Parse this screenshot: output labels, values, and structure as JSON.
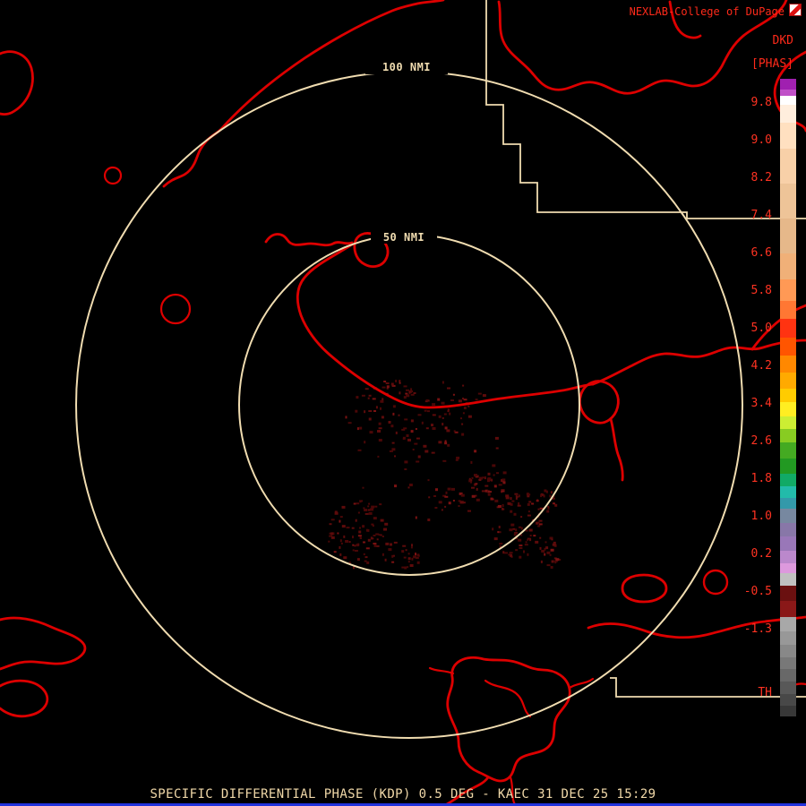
{
  "header": {
    "brand": "NEXLAB-College of DuPage",
    "product_code": "DKD",
    "units_label": "[PHAS]"
  },
  "colorbar": {
    "tick_labels": [
      "9.8",
      "9.0",
      "8.2",
      "7.4",
      "6.6",
      "5.8",
      "5.0",
      "4.2",
      "3.4",
      "2.6",
      "1.8",
      "1.0",
      "0.2",
      "-0.5",
      "-1.3"
    ],
    "threshold_label": "TH",
    "segments": [
      [
        "#a020b0",
        12
      ],
      [
        "#c050c8",
        8
      ],
      [
        "#ffffff",
        10
      ],
      [
        "#ffeedd",
        20
      ],
      [
        "#ffe0c0",
        30
      ],
      [
        "#f8d0a8",
        40
      ],
      [
        "#eec498",
        40
      ],
      [
        "#e6b88a",
        40
      ],
      [
        "#f0b078",
        30
      ],
      [
        "#ff9955",
        25
      ],
      [
        "#ff7733",
        20
      ],
      [
        "#ff3311",
        22
      ],
      [
        "#ff5500",
        20
      ],
      [
        "#ff8800",
        20
      ],
      [
        "#ffaa00",
        18
      ],
      [
        "#ffcc00",
        16
      ],
      [
        "#ffee22",
        16
      ],
      [
        "#ccee33",
        14
      ],
      [
        "#88cc22",
        16
      ],
      [
        "#44aa22",
        18
      ],
      [
        "#229922",
        18
      ],
      [
        "#11aa66",
        14
      ],
      [
        "#22bbaa",
        14
      ],
      [
        "#3399aa",
        12
      ],
      [
        "#7788a0",
        16
      ],
      [
        "#8877a8",
        16
      ],
      [
        "#9977b8",
        16
      ],
      [
        "#bb88cc",
        14
      ],
      [
        "#dd99dd",
        12
      ],
      [
        "#c0c0c0",
        14
      ],
      [
        "#6a1010",
        18
      ],
      [
        "#8a1818",
        18
      ],
      [
        "#a8a8a8",
        16
      ],
      [
        "#989898",
        16
      ],
      [
        "#888888",
        14
      ],
      [
        "#787878",
        14
      ],
      [
        "#686868",
        14
      ],
      [
        "#585858",
        14
      ],
      [
        "#484848",
        14
      ],
      [
        "#383838",
        12
      ]
    ]
  },
  "map": {
    "outer_ring_label": "100 NMI",
    "inner_ring_label": "50 NMI"
  },
  "footer": {
    "caption": "SPECIFIC DIFFERENTIAL PHASE (KDP) 0.5 DEG - KAEC 31 DEC 25 15:29"
  },
  "colors": {
    "background": "#000000",
    "map_line": "#dd0000",
    "range_ring": "#f0dcb0",
    "boundary": "#f0dcb0",
    "header_text": "#ff2a1a",
    "tick_text": "#ff3322",
    "footer_text": "#f0d8a8",
    "echo_dark": "#4a0707",
    "echo_mid": "#5d0b0b",
    "echo_bright": "#7a1212",
    "bottom_bar": "#2233dd"
  }
}
